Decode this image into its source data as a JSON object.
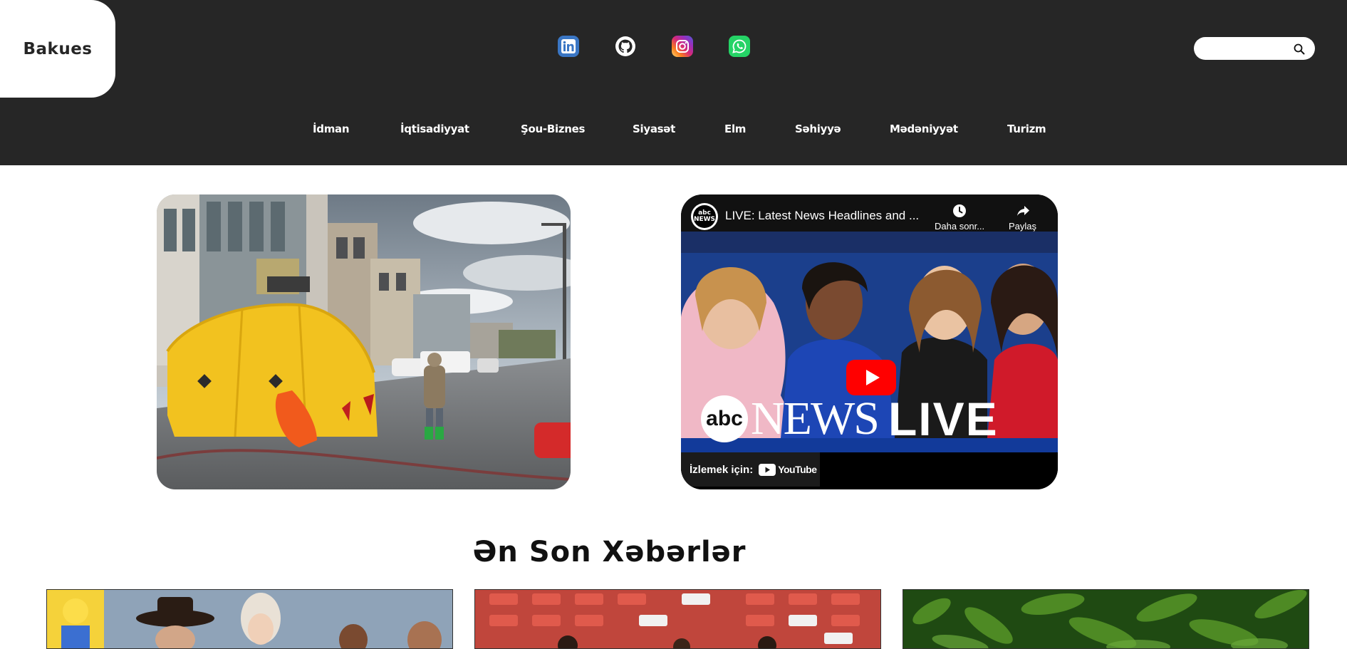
{
  "header": {
    "logo_text": "Bakues",
    "socials": [
      {
        "name": "linkedin",
        "color": "#3a76c4"
      },
      {
        "name": "github",
        "color": "#ffffff"
      },
      {
        "name": "instagram",
        "color": "#d6249f"
      },
      {
        "name": "whatsapp",
        "color": "#25d366"
      }
    ],
    "search": {
      "placeholder": "",
      "value": ""
    },
    "nav": [
      "İdman",
      "İqtisadiyyat",
      "Şou-Biznes",
      "Siyasət",
      "Elm",
      "Səhiyyə",
      "Mədəniyyət",
      "Turizm"
    ]
  },
  "hero": {
    "video": {
      "title": "LIVE: Latest News Headlines and ...",
      "watch_later_label": "Daha sonr...",
      "share_label": "Paylaş",
      "watch_on_label": "İzlemek için:",
      "youtube_label": "YouTube",
      "banner_abc": "abc",
      "banner_news": "NEWS",
      "banner_live": "LIVE",
      "channel_badge": "abc NEWS"
    }
  },
  "section": {
    "title": "Ən Son Xəbərlər"
  },
  "colors": {
    "header_bg": "#262626",
    "page_bg": "#ffffff",
    "youtube_red": "#ff0000"
  }
}
